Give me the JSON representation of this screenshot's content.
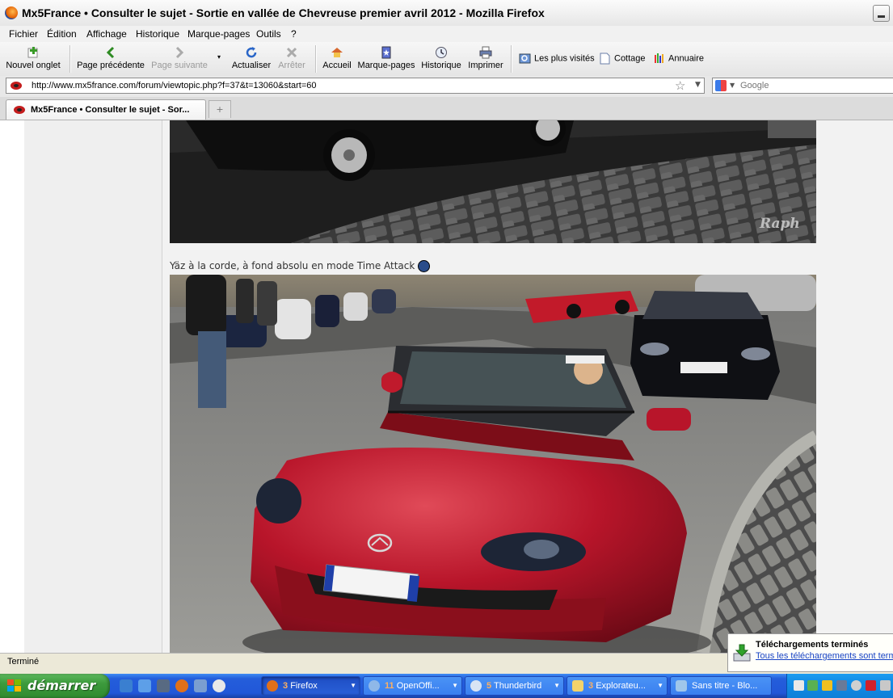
{
  "window": {
    "title": "Mx5France • Consulter le sujet - Sortie en vallée de Chevreuse premier avril 2012 - Mozilla Firefox"
  },
  "menu": [
    "Fichier",
    "Édition",
    "Affichage",
    "Historique",
    "Marque-pages",
    "Outils",
    "?"
  ],
  "toolbar": {
    "new_tab": "Nouvel onglet",
    "back": "Page précédente",
    "forward": "Page suivante",
    "reload": "Actualiser",
    "stop": "Arrêter",
    "home": "Accueil",
    "bookmarks": "Marque-pages",
    "history": "Historique",
    "print": "Imprimer"
  },
  "bookmarks_bar": [
    "Les plus visités",
    "Cottage",
    "Annuaire"
  ],
  "navbar": {
    "url": "http://www.mx5france.com/forum/viewtopic.php?f=37&t=13060&start=60",
    "search_placeholder": "Google"
  },
  "tabs": [
    {
      "label": "Mx5France • Consulter le sujet - Sor..."
    }
  ],
  "post": {
    "caption": "Yäz à la corde, à fond absolu en mode Time Attack",
    "watermark": "Raph"
  },
  "statusbar": {
    "text": "Terminé"
  },
  "download_popup": {
    "title": "Téléchargements terminés",
    "link": "Tous les téléchargements sont terminés"
  },
  "taskbar": {
    "start": "démarrer",
    "tasks": [
      {
        "count": "3",
        "label": "Firefox",
        "active": true
      },
      {
        "count": "11",
        "label": "OpenOffi...",
        "active": false
      },
      {
        "count": "5",
        "label": "Thunderbird",
        "active": false
      },
      {
        "count": "3",
        "label": "Explorateu...",
        "active": false
      },
      {
        "count": "",
        "label": "Sans titre - Blo...",
        "active": false
      }
    ]
  },
  "colors": {
    "car_red": "#b8152a",
    "link_blue": "#1844c4",
    "taskbar_blue": "#245edb"
  }
}
